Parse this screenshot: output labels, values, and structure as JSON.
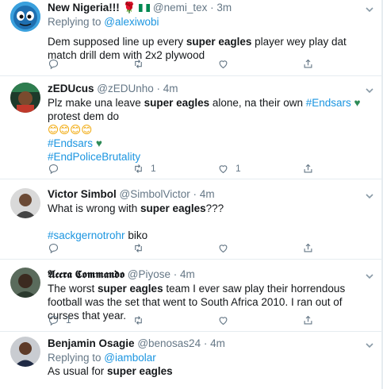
{
  "tweets": [
    {
      "name": "New Nigeria!!!",
      "handle": "@nemi_tex",
      "time": "3m",
      "replying_prefix": "Replying to ",
      "replying_to": "@alexiwobi",
      "text_a": "Dem supposed line up every ",
      "text_b": "super eagles",
      "text_c": " player wey play dat match drill dem with 2x2 plywood",
      "reply_count": "",
      "retweet_count": "",
      "like_count": ""
    },
    {
      "name": "zEDUcus",
      "handle": "@zEDUnho",
      "time": "4m",
      "text_a": "Plz make una leave ",
      "text_b": "super eagles",
      "text_c": " alone, na their own ",
      "hashtag_1": "#Endsars",
      "text_d": " protest dem do",
      "emoji_line": "😊😊😊😊",
      "hashtag_2": "#Endsars",
      "hashtag_3": "#EndPoliceBrutality",
      "reply_count": "",
      "retweet_count": "1",
      "like_count": "1"
    },
    {
      "name": "Victor Simbol",
      "handle": "@SimbolVictor",
      "time": "4m",
      "text_a": "What is wrong with ",
      "text_b": "super eagles",
      "text_c": "???",
      "hashtag_1": "#sackgernotrohr",
      "text_d": " biko",
      "reply_count": "",
      "retweet_count": "",
      "like_count": ""
    },
    {
      "name": "𝕬𝖈𝖈𝖗𝖆 𝕮𝖔𝖒𝖒𝖆𝖓𝖉𝖔",
      "handle": "@Piyose",
      "time": "4m",
      "text_a": "The worst ",
      "text_b": "super eagles",
      "text_c": " team I ever saw play their horrendous football was the set that went to South Africa 2010. I ran out of curses that year.",
      "reply_count": "1",
      "retweet_count": "",
      "like_count": ""
    },
    {
      "name": "Benjamin Osagie",
      "handle": "@benosas24",
      "time": "4m",
      "replying_prefix": "Replying to ",
      "replying_to": "@iambolar",
      "text_a": "As usual for ",
      "text_b": "super eagles",
      "text_c": ""
    }
  ],
  "colors": {
    "link": "#1b95e0",
    "muted": "#657786",
    "divider": "#e6ecf0"
  },
  "icons": [
    "reply-icon",
    "retweet-icon",
    "like-icon",
    "share-icon",
    "chevron-down-icon",
    "flag-nigeria-icon",
    "rose-icon",
    "green-heart-icon"
  ]
}
